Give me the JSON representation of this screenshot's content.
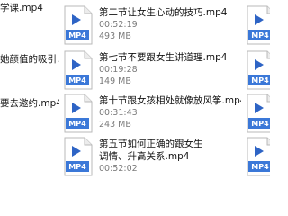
{
  "left_column": [
    "学课.mp4",
    "她颜值的吸引.",
    "要去邀约.mp4"
  ],
  "files": [
    {
      "name": "第二节让女生心动的技巧.mp4",
      "duration": "00:52:19",
      "size": "493 MB"
    },
    {
      "name": "第七节不要跟女生讲道理.mp4",
      "duration": "00:19:28",
      "size": "149 MB"
    },
    {
      "name": "第十节跟女孩相处就像放风筝.mp4",
      "duration": "00:31:43",
      "size": "243 MB"
    },
    {
      "name": "第五节如何正确的跟女生调情、升高关系.mp4",
      "duration": "00:52:02",
      "size": ""
    }
  ],
  "icon": {
    "type": "mp4-video-file-icon",
    "label": "MP4",
    "badge_color": "#3b78d8",
    "play_color": "#2e64c5"
  }
}
